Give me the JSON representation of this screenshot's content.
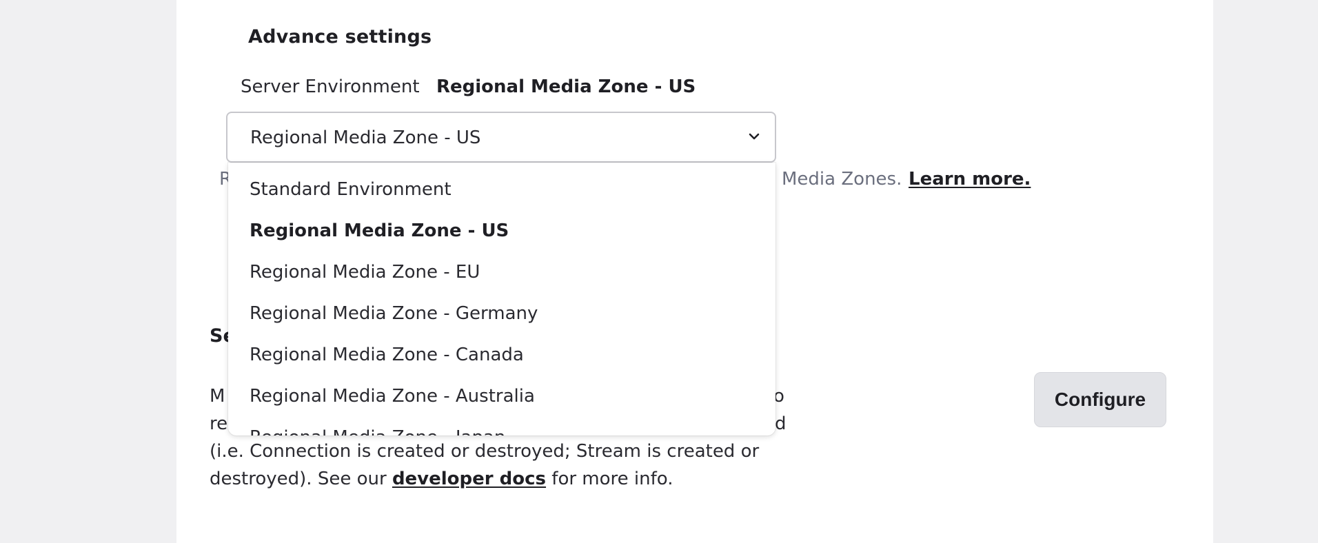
{
  "advanced": {
    "title": "Advance settings",
    "env_label": "Server Environment",
    "env_value": "Regional Media Zone - US",
    "select_value": "Regional Media Zone - US",
    "help_start": "R",
    "help_end": "Media Zones.",
    "learn_more": "Learn more."
  },
  "dropdown": {
    "options": [
      "Standard Environment",
      "Regional Media Zone - US",
      "Regional Media Zone - EU",
      "Regional Media Zone - Germany",
      "Regional Media Zone - Canada",
      "Regional Media Zone - Australia",
      "Regional Media Zone - Japan"
    ],
    "selected": "Regional Media Zone - US"
  },
  "section": {
    "title_fragment": "Se",
    "desc_line1_left": "M",
    "desc_line1_right": "o",
    "desc_line2_left": "re",
    "desc_line2_right": "d",
    "desc_line3": "(i.e. Connection is created or destroyed; Stream is created or",
    "desc_line4_prefix": "destroyed). See our ",
    "desc_line4_link": "developer docs",
    "desc_line4_suffix": " for more info.",
    "configure_label": "Configure"
  },
  "icons": {
    "chevron": "chevron-down-icon"
  }
}
